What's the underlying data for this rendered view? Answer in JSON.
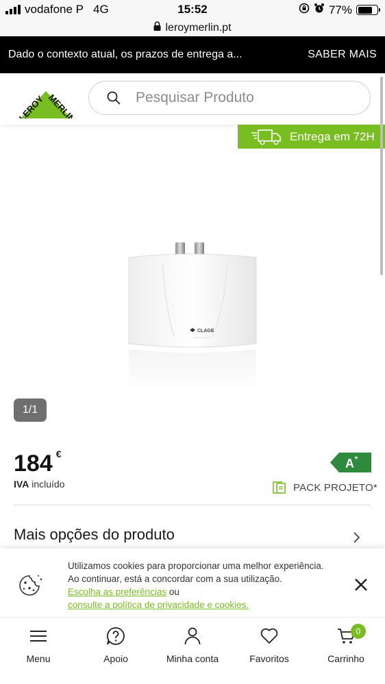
{
  "status_bar": {
    "carrier": "vodafone P",
    "network": "4G",
    "time": "15:52",
    "battery": "77%",
    "battery_level": 0.77
  },
  "browser": {
    "url": "leroymerlin.pt"
  },
  "banner": {
    "message": "Dado o contexto atual, os prazos de entrega a...",
    "action": "SABER MAIS"
  },
  "header": {
    "logo": "LEROY MERLIN",
    "search_placeholder": "Pesquisar Produto"
  },
  "delivery_badge": "Entrega em 72H",
  "product": {
    "image_brand": "CLAGE",
    "image_counter": "1/1",
    "price": "184",
    "currency": "€",
    "tax_bold": "IVA",
    "tax_rest": " incluído",
    "energy_class": "A",
    "energy_plus": "+",
    "pack": "PACK PROJETO*",
    "more_options": "Mais opções do produto"
  },
  "cookie": {
    "line1": "Utilizamos cookies para proporcionar uma melhor experiência.",
    "line2": "Ao continuar, está a concordar com a sua utilização.",
    "link_prefs": "Escolha as preferências",
    "or": " ou",
    "link_policy": "consulte a política de privacidade e cookies."
  },
  "bottom_nav": {
    "menu": "Menu",
    "support": "Apoio",
    "account": "Minha conta",
    "favorites": "Favoritos",
    "cart": "Carrinho",
    "cart_count": "0"
  },
  "colors": {
    "brand_green": "#78be20",
    "banner_bg": "#000000"
  }
}
